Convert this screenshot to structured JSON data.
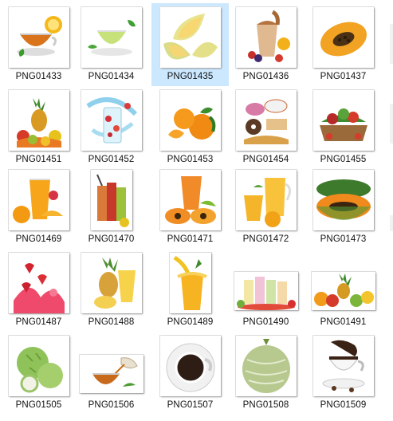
{
  "files": [
    {
      "name": "PNG01433",
      "icon": "tea-lemon-icon"
    },
    {
      "name": "PNG01434",
      "icon": "green-tea-icon"
    },
    {
      "name": "PNG01435",
      "icon": "melon-slices-icon",
      "selected": true
    },
    {
      "name": "PNG01436",
      "icon": "smoothie-splash-icon"
    },
    {
      "name": "PNG01437",
      "icon": "papaya-half-icon"
    },
    {
      "name": "PNG01451",
      "icon": "fruit-pile-icon"
    },
    {
      "name": "PNG01452",
      "icon": "splash-glass-icon"
    },
    {
      "name": "PNG01453",
      "icon": "oranges-icon"
    },
    {
      "name": "PNG01454",
      "icon": "desserts-icon"
    },
    {
      "name": "PNG01455",
      "icon": "vegetable-basket-icon"
    },
    {
      "name": "PNG01469",
      "icon": "orange-juice-icon"
    },
    {
      "name": "PNG01470",
      "icon": "juice-glasses-icon"
    },
    {
      "name": "PNG01471",
      "icon": "papaya-juice-icon"
    },
    {
      "name": "PNG01472",
      "icon": "juice-pitcher-icon"
    },
    {
      "name": "PNG01473",
      "icon": "papaya-halves-icon"
    },
    {
      "name": "PNG01487",
      "icon": "strawberry-splash-icon"
    },
    {
      "name": "PNG01488",
      "icon": "pineapple-juice-icon"
    },
    {
      "name": "PNG01489",
      "icon": "pineapple-splash-icon"
    },
    {
      "name": "PNG01490",
      "icon": "smoothie-row-icon"
    },
    {
      "name": "PNG01491",
      "icon": "tropical-fruits-icon"
    },
    {
      "name": "PNG01505",
      "icon": "custard-apple-icon"
    },
    {
      "name": "PNG01506",
      "icon": "teapot-pour-icon"
    },
    {
      "name": "PNG01507",
      "icon": "coffee-cup-icon"
    },
    {
      "name": "PNG01508",
      "icon": "cantaloupe-icon"
    },
    {
      "name": "PNG01509",
      "icon": "coffee-splash-icon"
    }
  ]
}
